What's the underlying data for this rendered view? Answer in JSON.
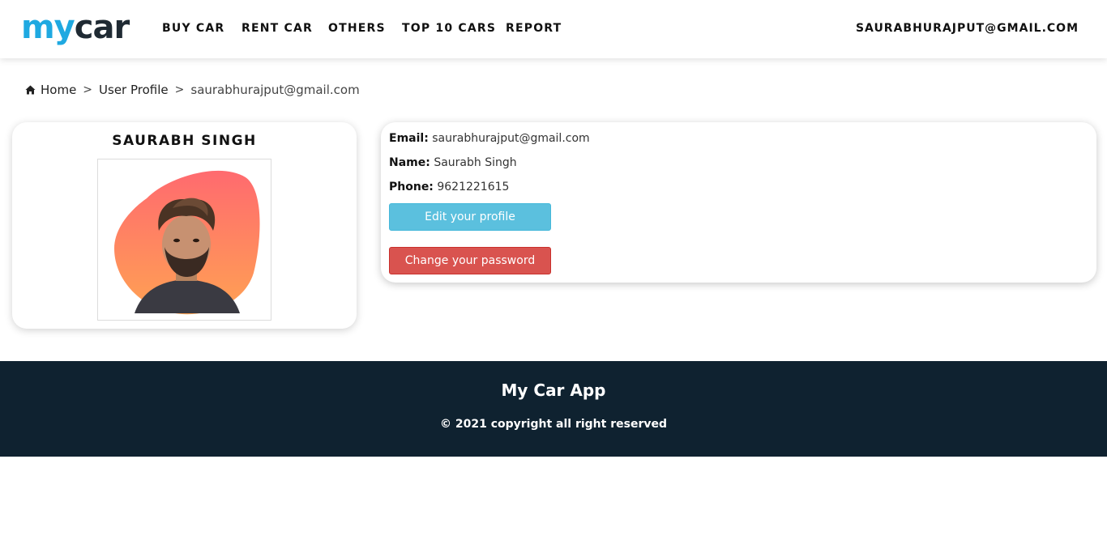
{
  "header": {
    "logo": {
      "part1": "my",
      "part2": "car"
    },
    "nav": [
      "BUY CAR",
      "RENT CAR",
      "OTHERS",
      "TOP 10 CARS",
      "REPORT"
    ],
    "user_email": "SAURABHURAJPUT@GMAIL.COM"
  },
  "breadcrumb": {
    "home": "Home",
    "section": "User Profile",
    "current": "saurabhurajput@gmail.com",
    "separator": ">"
  },
  "profile": {
    "name": "SAURABH SINGH",
    "photo_icon": "profile-photo",
    "blob_colors": [
      "#ff6a6f",
      "#ffa253"
    ]
  },
  "details": {
    "email_label": "Email:",
    "email_value": "saurabhurajput@gmail.com",
    "name_label": "Name:",
    "name_value": "Saurabh Singh",
    "phone_label": "Phone:",
    "phone_value": "9621221615",
    "edit_button": "Edit your profile",
    "password_button": "Change your password"
  },
  "footer": {
    "title": "My Car App",
    "copyright": "© 2021 copyright all right reserved",
    "background": "#0f2230"
  },
  "colors": {
    "brand_blue": "#1fa9e1",
    "info": "#5bc0de",
    "danger": "#d9534f"
  }
}
